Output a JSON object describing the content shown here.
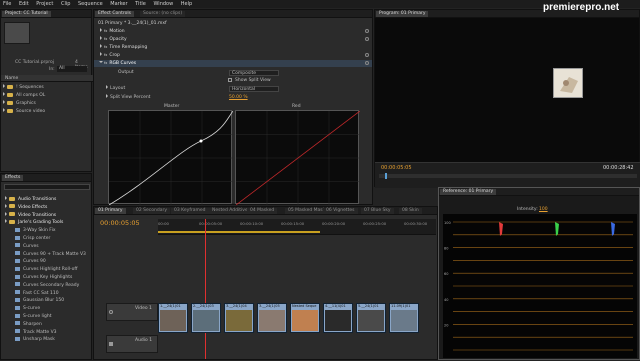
{
  "menu": [
    "File",
    "Edit",
    "Project",
    "Clip",
    "Sequence",
    "Marker",
    "Title",
    "Window",
    "Help"
  ],
  "watermark": "premierepro.net",
  "project": {
    "tab": "Project: CC Tutorial",
    "filename": "CC Tutorial.prproj",
    "count": "4 Items",
    "in_label": "In:",
    "in_value": "All",
    "name_header": "Name",
    "items": [
      "! Sequences",
      "All comps OL",
      "Graphics",
      "Source video"
    ]
  },
  "effect_controls": {
    "tabs": [
      "Effect Controls",
      "Source: (no clips)"
    ],
    "clip": "01 Primary * 3.__24(1)_01.mxf",
    "motion": "Motion",
    "opacity": "Opacity",
    "time_remapping": "Time Remapping",
    "crop": "Crop",
    "rgb_curves": "RGB Curves",
    "output_label": "Output",
    "output_value": "Composite",
    "show_split": "Show Split View",
    "layout_label": "Layout",
    "layout_value": "Horizontal",
    "split_label": "Split View Percent",
    "split_value": "50.00 %",
    "master_label": "Master",
    "red_label": "Red"
  },
  "program": {
    "tab": "Program: 01 Primary",
    "timecode_left": "00:00:05:05",
    "timecode_right": "00:00:28:42"
  },
  "effects": {
    "tab": "Effects",
    "items": [
      {
        "label": "Audio Transitions",
        "type": "folder",
        "indent": 1
      },
      {
        "label": "Video Effects",
        "type": "folder",
        "indent": 1
      },
      {
        "label": "Video Transitions",
        "type": "folder",
        "indent": 1
      },
      {
        "label": "Jarle's Grading Tools",
        "type": "folder",
        "indent": 1
      },
      {
        "label": "3-Way Skin Fix",
        "type": "preset",
        "indent": 2
      },
      {
        "label": "Crisp center",
        "type": "preset",
        "indent": 2
      },
      {
        "label": "Curves",
        "type": "preset",
        "indent": 2
      },
      {
        "label": "Curves 90 + Track Matte V3",
        "type": "preset",
        "indent": 2
      },
      {
        "label": "Curves 90",
        "type": "preset",
        "indent": 2
      },
      {
        "label": "Curves Highlight Roll-off",
        "type": "preset",
        "indent": 2
      },
      {
        "label": "Curves Key Highlights",
        "type": "preset",
        "indent": 2
      },
      {
        "label": "Curves Secondary Ready",
        "type": "preset",
        "indent": 2
      },
      {
        "label": "Fast CC Sat 110",
        "type": "preset",
        "indent": 2
      },
      {
        "label": "Gaussian Blur 150",
        "type": "preset",
        "indent": 2
      },
      {
        "label": "S-curve",
        "type": "preset",
        "indent": 2
      },
      {
        "label": "S-curve light",
        "type": "preset",
        "indent": 2
      },
      {
        "label": "Sharpen",
        "type": "preset",
        "indent": 2
      },
      {
        "label": "Track Matte V3",
        "type": "preset",
        "indent": 2
      },
      {
        "label": "Unsharp Mask",
        "type": "preset",
        "indent": 2
      }
    ]
  },
  "timeline": {
    "tabs": [
      "01 Primary",
      "02 Secondary",
      "03 Keyframed",
      "Nested Additive",
      "04 Masked",
      "05 Masked Mask",
      "06 Vignettes",
      "07 Blue Sky",
      "08 Skin"
    ],
    "timecode": "00:00:05:05",
    "ruler": [
      "00:00",
      "00:00:05:00",
      "00:00:10:00",
      "00:00:15:00",
      "00:00:20:00",
      "00:00:25:00",
      "00:00:30:00"
    ],
    "video_track": "Video 1",
    "audio_track": "Audio 1",
    "clips": [
      "1.__24(1)01",
      "2.__24(1)03",
      "3.__24(1)04",
      "3.__24(1)05",
      "Nested Seque",
      "4.__11(4)01",
      "5.__24(1)01",
      "11.09(1)01"
    ]
  },
  "reference": {
    "tab": "Reference: 01 Primary",
    "intensity_label": "Intensity:",
    "intensity_value": "100",
    "scale": [
      "100",
      "80",
      "60",
      "40",
      "20"
    ],
    "colors": {
      "red": "#e23a3a",
      "green": "#3ad04a",
      "blue": "#3a6ae2",
      "grid": "#a46a1a"
    }
  }
}
